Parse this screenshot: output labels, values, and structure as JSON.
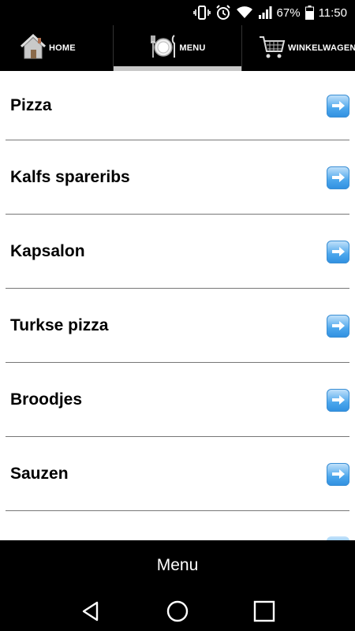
{
  "status_bar": {
    "battery_percent": "67%",
    "time": "11:50",
    "icons": [
      "vibrate-icon",
      "alarm-icon",
      "wifi-icon",
      "signal-icon",
      "battery-icon"
    ]
  },
  "tabs": [
    {
      "label": "HOME",
      "icon": "house-icon",
      "selected": false
    },
    {
      "label": "MENU",
      "icon": "plate-cutlery-icon",
      "selected": true
    },
    {
      "label": "WINKELWAGEN",
      "icon": "cart-icon",
      "selected": false
    }
  ],
  "menu_items": [
    {
      "label": "Pizza"
    },
    {
      "label": "Kalfs spareribs"
    },
    {
      "label": "Kapsalon"
    },
    {
      "label": "Turkse pizza"
    },
    {
      "label": "Broodjes"
    },
    {
      "label": "Sauzen"
    }
  ],
  "bottom_title": "Menu",
  "nav": [
    "back-icon",
    "home-circle-icon",
    "recents-icon"
  ],
  "colors": {
    "accent_arrow": "#4ba6ec",
    "tab_indicator": "#c8c8c8"
  }
}
